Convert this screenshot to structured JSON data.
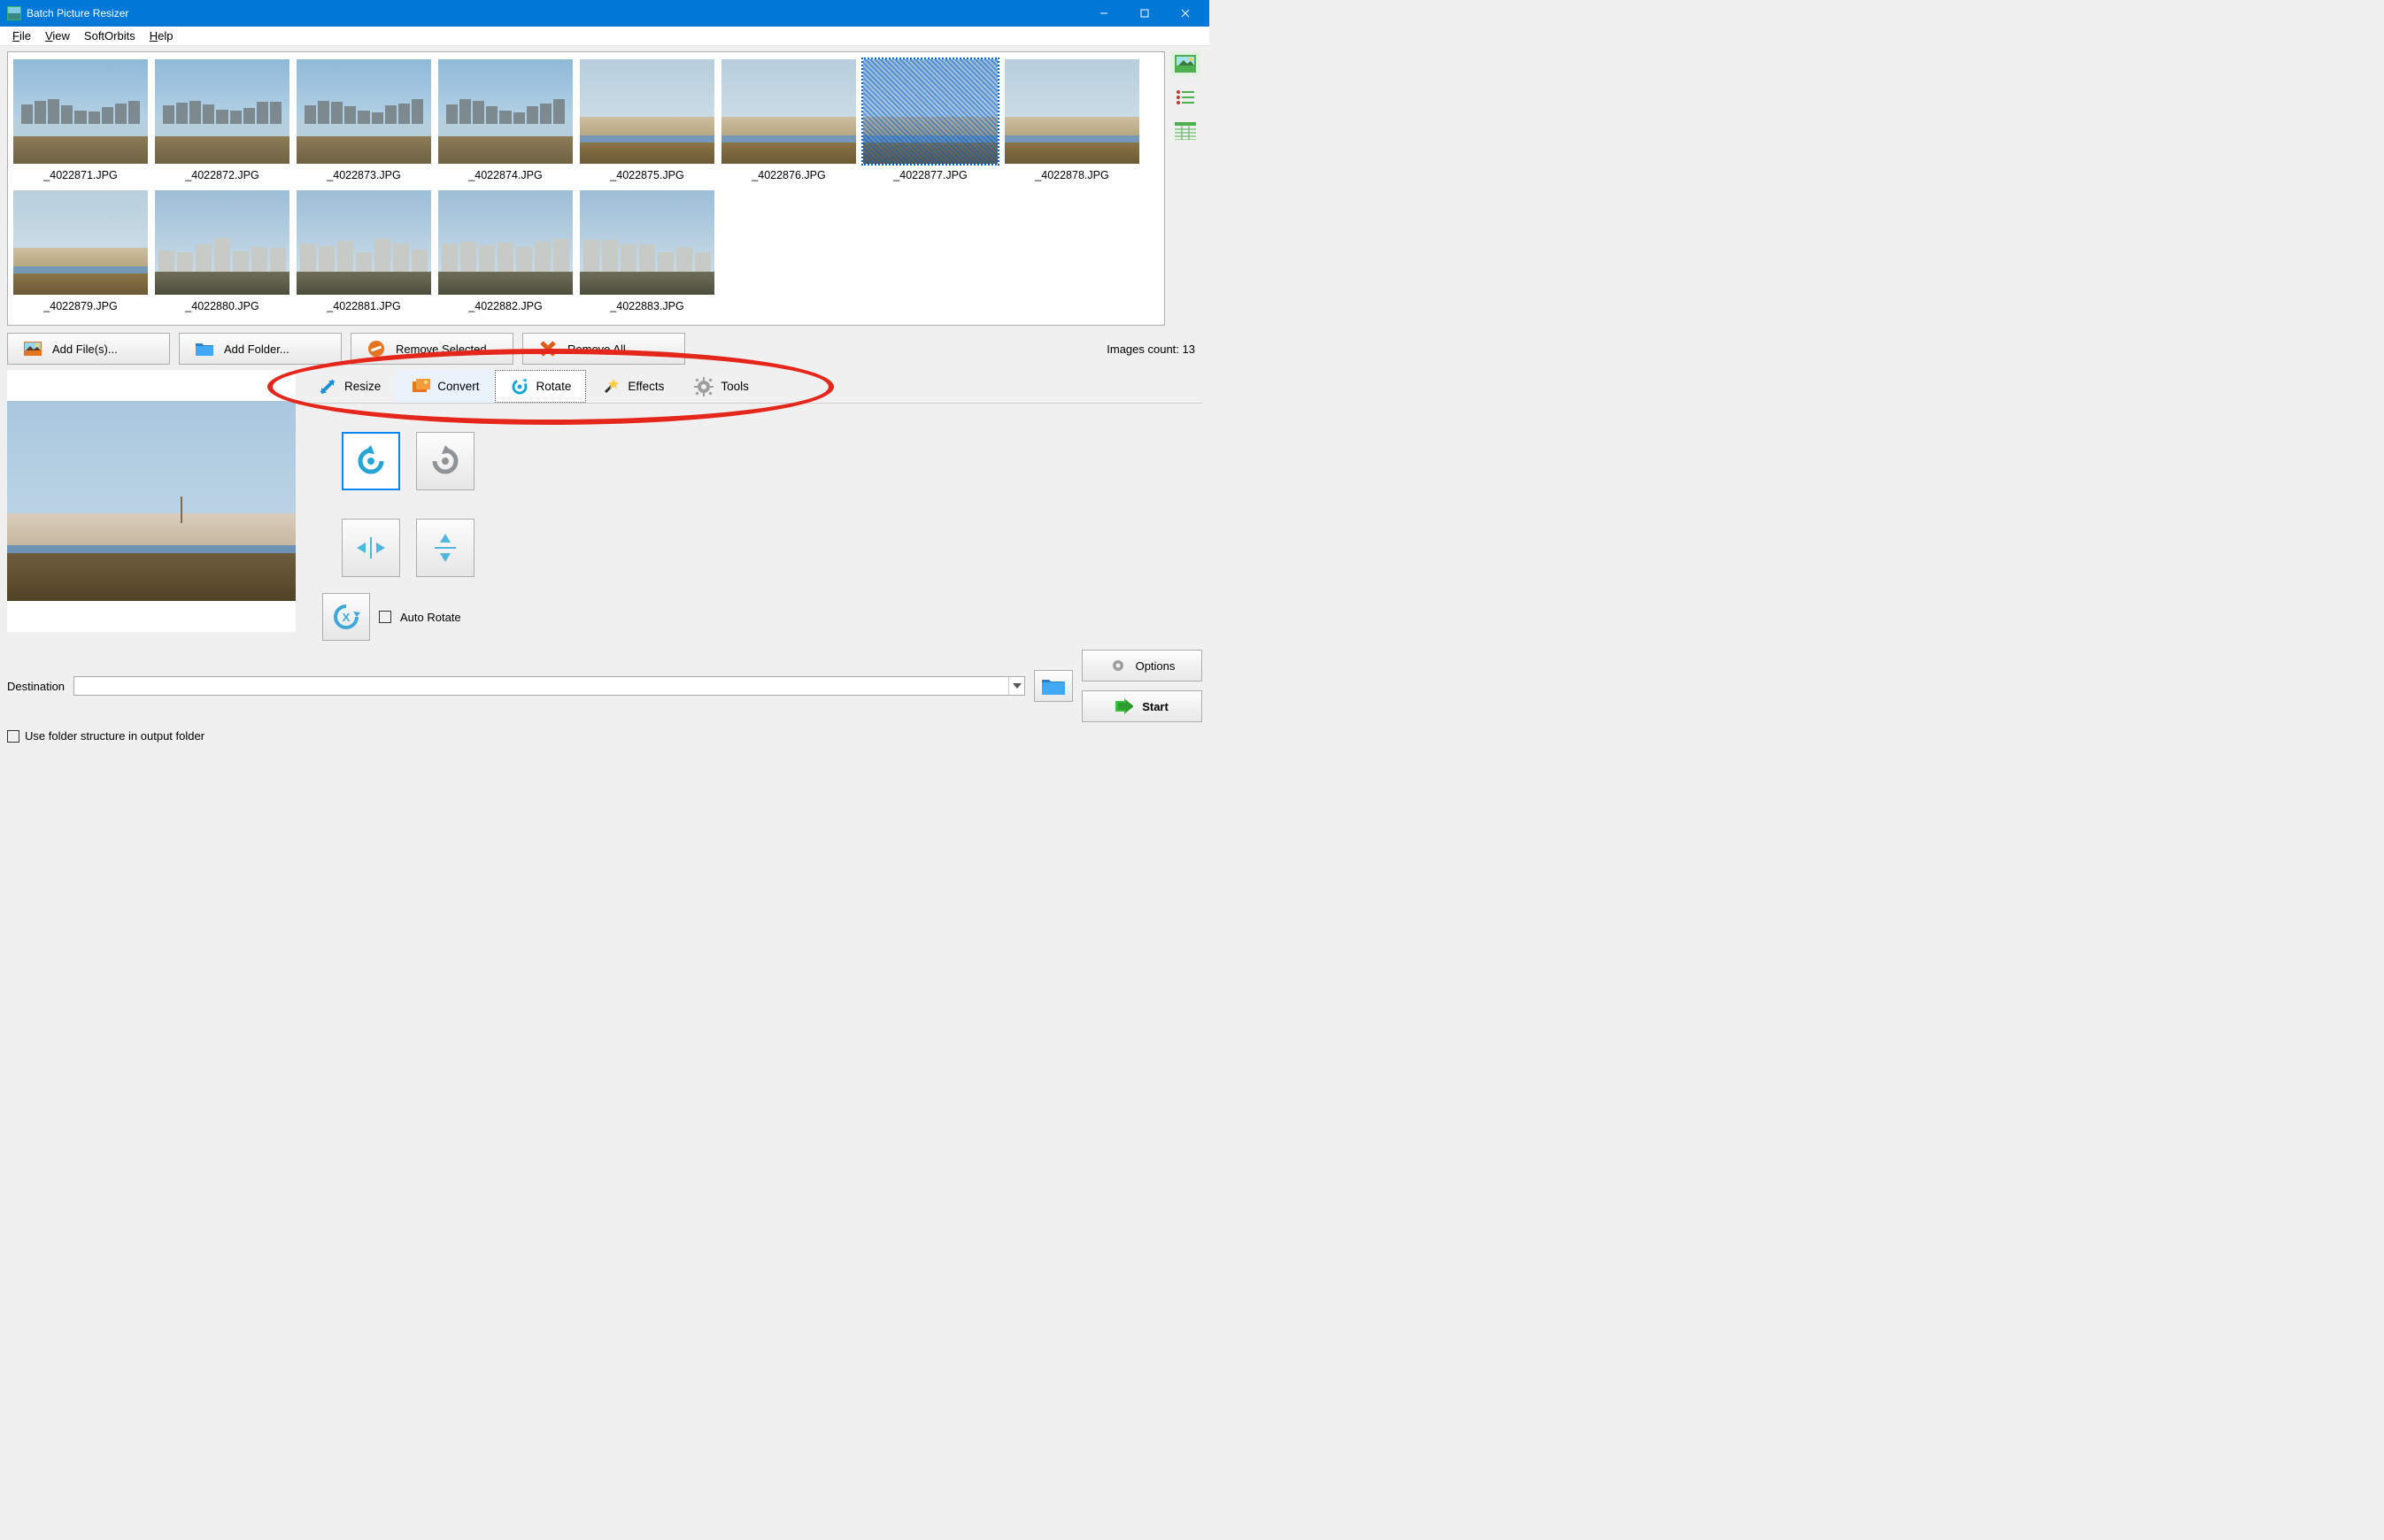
{
  "titlebar": {
    "title": "Batch Picture Resizer"
  },
  "menu": {
    "items": [
      "File",
      "View",
      "SoftOrbits",
      "Help"
    ]
  },
  "thumbnails": [
    {
      "name": "_4022871.JPG",
      "kind": "city"
    },
    {
      "name": "_4022872.JPG",
      "kind": "city"
    },
    {
      "name": "_4022873.JPG",
      "kind": "city"
    },
    {
      "name": "_4022874.JPG",
      "kind": "city"
    },
    {
      "name": "_4022875.JPG",
      "kind": "flat"
    },
    {
      "name": "_4022876.JPG",
      "kind": "flat"
    },
    {
      "name": "_4022877.JPG",
      "kind": "flat",
      "selected": true
    },
    {
      "name": "_4022878.JPG",
      "kind": "flat"
    },
    {
      "name": "_4022879.JPG",
      "kind": "flat"
    },
    {
      "name": "_4022880.JPG",
      "kind": "blocks"
    },
    {
      "name": "_4022881.JPG",
      "kind": "blocks"
    },
    {
      "name": "_4022882.JPG",
      "kind": "blocks"
    },
    {
      "name": "_4022883.JPG",
      "kind": "blocks"
    }
  ],
  "actions": {
    "add_files": "Add File(s)...",
    "add_folder": "Add Folder...",
    "remove_selected": "Remove Selected",
    "remove_all": "Remove All",
    "images_count_label": "Images count:",
    "images_count_value": "13"
  },
  "tabs": {
    "resize": "Resize",
    "convert": "Convert",
    "rotate": "Rotate",
    "effects": "Effects",
    "tools": "Tools",
    "active": "rotate"
  },
  "rotate_panel": {
    "auto_rotate": "Auto Rotate"
  },
  "bottom": {
    "destination_label": "Destination",
    "destination_value": "",
    "use_folder_structure": "Use folder structure in output folder",
    "options": "Options",
    "start": "Start"
  },
  "annotation": {
    "description": "red ellipse highlighting the tab strip (Resize / Convert / Rotate / Effects / Tools)"
  }
}
